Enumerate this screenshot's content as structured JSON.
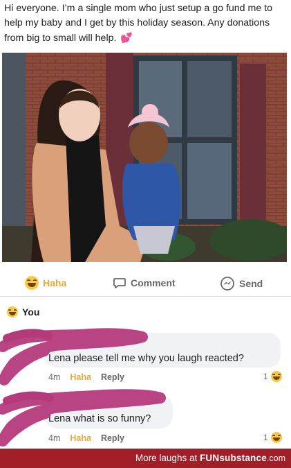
{
  "post": {
    "text": "Hi everyone. I’m a single mom who just setup a go fund me to help my baby and I get by this holiday season. Any donations from big to small will help."
  },
  "actions": {
    "haha_label": "Haha",
    "comment_label": "Comment",
    "send_label": "Send"
  },
  "reaction_summary": {
    "name": "You"
  },
  "comments": [
    {
      "text": "Lena please tell me why you laugh reacted?",
      "time": "4m",
      "reaction": "Haha",
      "reply": "Reply",
      "count": "1"
    },
    {
      "text": "Lena what is so funny?",
      "time": "4m",
      "reaction": "Haha",
      "reply": "Reply",
      "count": "1"
    }
  ],
  "footer": {
    "prefix": "More laughs at ",
    "brand_fun": "FUN",
    "brand_sub": "substance",
    "domain": ".com"
  },
  "colors": {
    "haha": "#e8a93b",
    "footer_bg": "#a01e25",
    "redaction": "#b53a7c"
  }
}
